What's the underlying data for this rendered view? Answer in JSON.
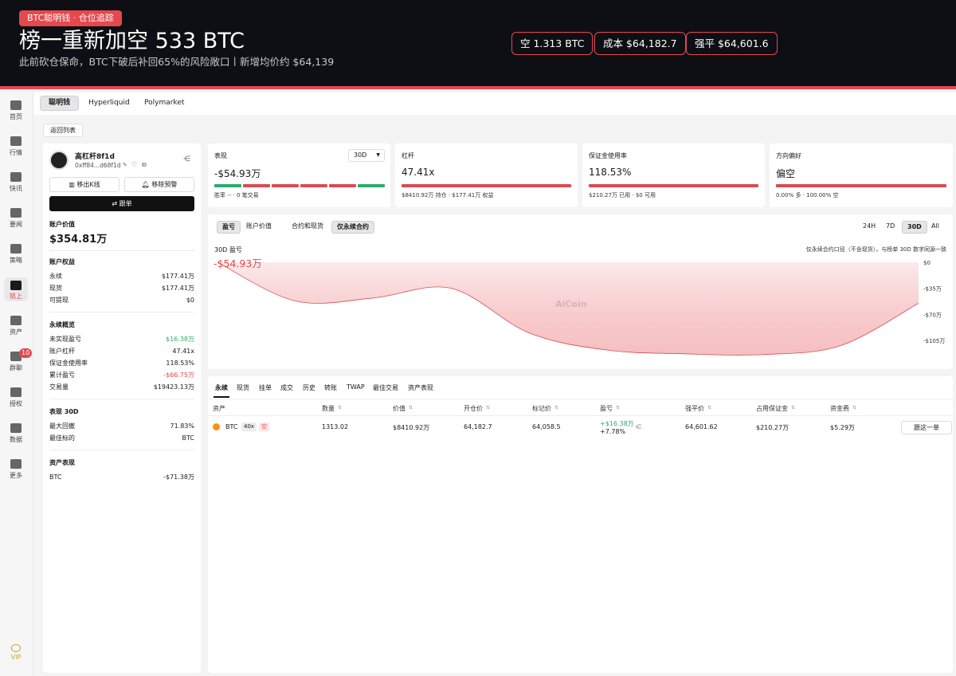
{
  "banner": {
    "tag": "BTC聪明钱 · 仓位追踪",
    "title": "榜一重新加空 533 BTC",
    "subtitle": "此前砍仓保命，BTC下破后补回65%的风险敞口丨新增均价约 $64,139",
    "pills": [
      "空 1.313 BTC",
      "成本 $64,182.7",
      "强平 $64,601.6"
    ]
  },
  "sidebar": {
    "items": [
      "首页",
      "行情",
      "快讯",
      "要闻",
      "策略",
      "链上",
      "资产",
      "群聊",
      "授权",
      "数据",
      "更多"
    ],
    "active": "链上",
    "chat_badge": "10",
    "vip": "VIP"
  },
  "tabs": [
    "聪明钱",
    "Hyperliquid",
    "Polymarket"
  ],
  "back_label": "返回列表",
  "profile": {
    "name": "高杠杆8f1d",
    "address": "0xff84...d68f1d",
    "btn_kline": "移出K线",
    "btn_alert": "移除预警",
    "btn_follow": "跟单",
    "account_value_label": "账户价值",
    "account_value": "$354.81万",
    "equity_title": "账户权益",
    "equity": [
      {
        "label": "永续",
        "value": "$177.41万"
      },
      {
        "label": "现货",
        "value": "$177.41万"
      },
      {
        "label": "可提现",
        "value": "$0"
      }
    ],
    "perp_title": "永续概览",
    "perp": [
      {
        "label": "未实现盈亏",
        "value": "$16.38万"
      },
      {
        "label": "账户杠杆",
        "value": "47.41x"
      },
      {
        "label": "保证金使用率",
        "value": "118.53%"
      },
      {
        "label": "累计盈亏",
        "value": "-$66.75万"
      },
      {
        "label": "交易量",
        "value": "$19423.13万"
      }
    ],
    "perf_title": "表现 30D",
    "perf": [
      {
        "label": "最大回撤",
        "value": "71.83%"
      },
      {
        "label": "最佳标的",
        "value": "BTC"
      }
    ],
    "asset_title": "资产表现",
    "asset": [
      {
        "label": "BTC",
        "value": "-$71.38万"
      }
    ]
  },
  "stats": {
    "perf": {
      "label": "表现",
      "period": "30D",
      "value": "-$54.93万",
      "foot": "胜率 -- · 0 笔交易",
      "segments": [
        "green",
        "red",
        "red",
        "red",
        "red",
        "green"
      ]
    },
    "leverage": {
      "label": "杠杆",
      "value": "47.41x",
      "foot": "$8410.92万 持仓 · $177.41万 权益"
    },
    "margin": {
      "label": "保证金使用率",
      "value": "118.53%",
      "foot": "$210.27万 已用 · $0 可用"
    },
    "direction": {
      "label": "方向偏好",
      "value": "偏空",
      "foot": "0.00% 多 · 100.00% 空"
    }
  },
  "chart_panel": {
    "metric_tabs": [
      "盈亏",
      "账户价值"
    ],
    "scope_tabs": [
      "合约和现货",
      "仅永续合约"
    ],
    "range_tabs": [
      "24H",
      "7D",
      "30D",
      "All"
    ],
    "chart_label": "30D 盈亏",
    "big_value": "-$54.93万",
    "note": "仅永续合约口径（不含现货），与榜单 30D 数字同源一致",
    "watermark": "AiCoin"
  },
  "chart_data": {
    "type": "area",
    "ylabel": "",
    "yticks": [
      "$0",
      "-$35万",
      "-$70万",
      "-$105万"
    ],
    "ylim": [
      -135,
      0
    ],
    "values": [
      0,
      -52,
      -48,
      -35,
      -95,
      -118,
      -123,
      -124,
      -112,
      -55
    ]
  },
  "positions": {
    "tabs": [
      "永续",
      "现货",
      "挂单",
      "成交",
      "历史",
      "转账",
      "TWAP",
      "最佳交易",
      "资产表现"
    ],
    "headers": [
      "资产",
      "数量",
      "价值",
      "开仓价",
      "标记价",
      "盈亏",
      "强平价",
      "占用保证金",
      "资金费"
    ],
    "row": {
      "asset": "BTC",
      "lev": "40x",
      "side": "空",
      "qty": "1313.02",
      "value": "$8410.92万",
      "entry": "64,182.7",
      "mark": "64,058.5",
      "pnl": "+$16.38万",
      "pnl_pct": "+7.78%",
      "liq": "64,601.62",
      "margin": "$210.27万",
      "funding": "$5.29万",
      "action": "跟这一单"
    }
  },
  "colors": {
    "accent": "#e5484d",
    "green": "#2eaa6e",
    "bg_dark": "#0d0f14"
  }
}
